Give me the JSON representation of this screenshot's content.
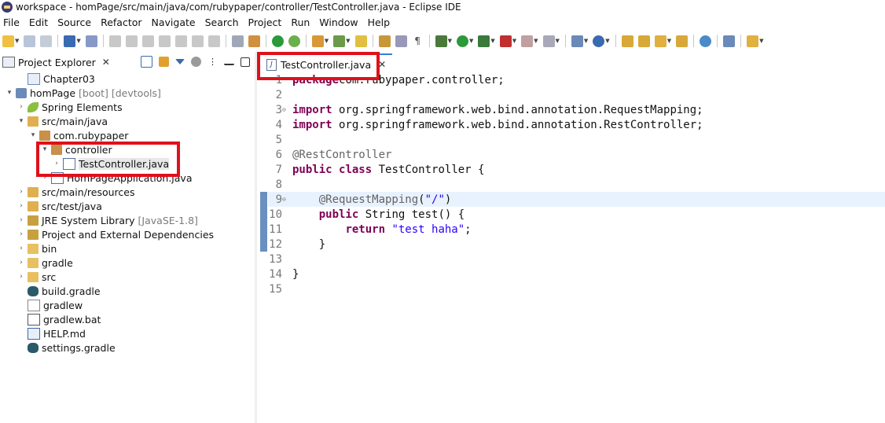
{
  "window": {
    "title": "workspace - homPage/src/main/java/com/rubypaper/controller/TestController.java - Eclipse IDE"
  },
  "menubar": {
    "items": [
      "File",
      "Edit",
      "Source",
      "Refactor",
      "Navigate",
      "Search",
      "Project",
      "Run",
      "Window",
      "Help"
    ]
  },
  "explorer": {
    "title": "Project Explorer",
    "tree": [
      {
        "label": "Chapter03",
        "deco": "",
        "indent": 1,
        "twisty": "",
        "icon": "folder-project-icon",
        "selected": false
      },
      {
        "label": "homPage",
        "deco": "[boot] [devtools]",
        "indent": 0,
        "twisty": "▾",
        "icon": "project-icon",
        "selected": false
      },
      {
        "label": "Spring Elements",
        "deco": "",
        "indent": 1,
        "twisty": "›",
        "icon": "spring-leaf-icon",
        "selected": false
      },
      {
        "label": "src/main/java",
        "deco": "",
        "indent": 1,
        "twisty": "▾",
        "icon": "source-folder-icon",
        "selected": false
      },
      {
        "label": "com.rubypaper",
        "deco": "",
        "indent": 2,
        "twisty": "▾",
        "icon": "package-icon",
        "selected": false
      },
      {
        "label": "controller",
        "deco": "",
        "indent": 3,
        "twisty": "▾",
        "icon": "package-icon",
        "selected": false
      },
      {
        "label": "TestController.java",
        "deco": "",
        "indent": 4,
        "twisty": "›",
        "icon": "java-file-icon",
        "selected": true
      },
      {
        "label": "HomPageApplication.java",
        "deco": "",
        "indent": 3,
        "twisty": "›",
        "icon": "java-file-icon",
        "selected": false
      },
      {
        "label": "src/main/resources",
        "deco": "",
        "indent": 1,
        "twisty": "›",
        "icon": "source-folder-icon",
        "selected": false
      },
      {
        "label": "src/test/java",
        "deco": "",
        "indent": 1,
        "twisty": "›",
        "icon": "source-folder-icon",
        "selected": false
      },
      {
        "label": "JRE System Library",
        "deco": "[JavaSE-1.8]",
        "indent": 1,
        "twisty": "›",
        "icon": "library-icon",
        "selected": false
      },
      {
        "label": "Project and External Dependencies",
        "deco": "",
        "indent": 1,
        "twisty": "›",
        "icon": "library-icon",
        "selected": false
      },
      {
        "label": "bin",
        "deco": "",
        "indent": 1,
        "twisty": "›",
        "icon": "folder-icon",
        "selected": false
      },
      {
        "label": "gradle",
        "deco": "",
        "indent": 1,
        "twisty": "›",
        "icon": "folder-icon",
        "selected": false
      },
      {
        "label": "src",
        "deco": "",
        "indent": 1,
        "twisty": "›",
        "icon": "folder-icon",
        "selected": false
      },
      {
        "label": "build.gradle",
        "deco": "",
        "indent": 1,
        "twisty": "",
        "icon": "gradle-elephant-icon",
        "selected": false
      },
      {
        "label": "gradlew",
        "deco": "",
        "indent": 1,
        "twisty": "",
        "icon": "file-icon",
        "selected": false
      },
      {
        "label": "gradlew.bat",
        "deco": "",
        "indent": 1,
        "twisty": "",
        "icon": "bat-file-icon",
        "selected": false
      },
      {
        "label": "HELP.md",
        "deco": "",
        "indent": 1,
        "twisty": "",
        "icon": "word-file-icon",
        "selected": false
      },
      {
        "label": "settings.gradle",
        "deco": "",
        "indent": 1,
        "twisty": "",
        "icon": "gradle-elephant-icon",
        "selected": false
      }
    ]
  },
  "editor": {
    "tab_label": "TestController.java",
    "current_line": 9,
    "lines": [
      {
        "n": "1",
        "fold": "",
        "segs": [
          [
            "kw",
            "package"
          ],
          [
            "",
            "com.rubypaper.controller;"
          ]
        ]
      },
      {
        "n": "2",
        "fold": "",
        "segs": []
      },
      {
        "n": "3",
        "fold": "⊖",
        "segs": [
          [
            "kw",
            "import"
          ],
          [
            "",
            " org.springframework.web.bind.annotation.RequestMapping;"
          ]
        ]
      },
      {
        "n": "4",
        "fold": "",
        "segs": [
          [
            "kw",
            "import"
          ],
          [
            "",
            " org.springframework.web.bind.annotation.RestController;"
          ]
        ]
      },
      {
        "n": "5",
        "fold": "",
        "segs": []
      },
      {
        "n": "6",
        "fold": "",
        "segs": [
          [
            "ann",
            "@RestController"
          ]
        ]
      },
      {
        "n": "7",
        "fold": "",
        "segs": [
          [
            "kw",
            "public"
          ],
          [
            "",
            " "
          ],
          [
            "kw",
            "class"
          ],
          [
            "",
            " TestController {"
          ]
        ]
      },
      {
        "n": "8",
        "fold": "",
        "segs": []
      },
      {
        "n": "9",
        "fold": "⊖",
        "segs": [
          [
            "",
            "    "
          ],
          [
            "ann",
            "@RequestMapping"
          ],
          [
            "",
            "("
          ],
          [
            "str",
            "\"/\""
          ],
          [
            "",
            ")"
          ]
        ]
      },
      {
        "n": "10",
        "fold": "",
        "segs": [
          [
            "",
            "    "
          ],
          [
            "kw",
            "public"
          ],
          [
            "",
            " String test() {"
          ]
        ]
      },
      {
        "n": "11",
        "fold": "",
        "segs": [
          [
            "",
            "        "
          ],
          [
            "kw",
            "return"
          ],
          [
            "",
            " "
          ],
          [
            "str",
            "\"test haha\""
          ],
          [
            "",
            ";"
          ]
        ]
      },
      {
        "n": "12",
        "fold": "",
        "segs": [
          [
            "",
            "    }"
          ]
        ]
      },
      {
        "n": "13",
        "fold": "",
        "segs": []
      },
      {
        "n": "14",
        "fold": "",
        "segs": [
          [
            "",
            "}"
          ]
        ]
      },
      {
        "n": "15",
        "fold": "",
        "segs": []
      }
    ]
  },
  "colors": {
    "highlight": "#e0101a",
    "keyword": "#7f0055",
    "annotation": "#646464",
    "string": "#2a00ff"
  }
}
